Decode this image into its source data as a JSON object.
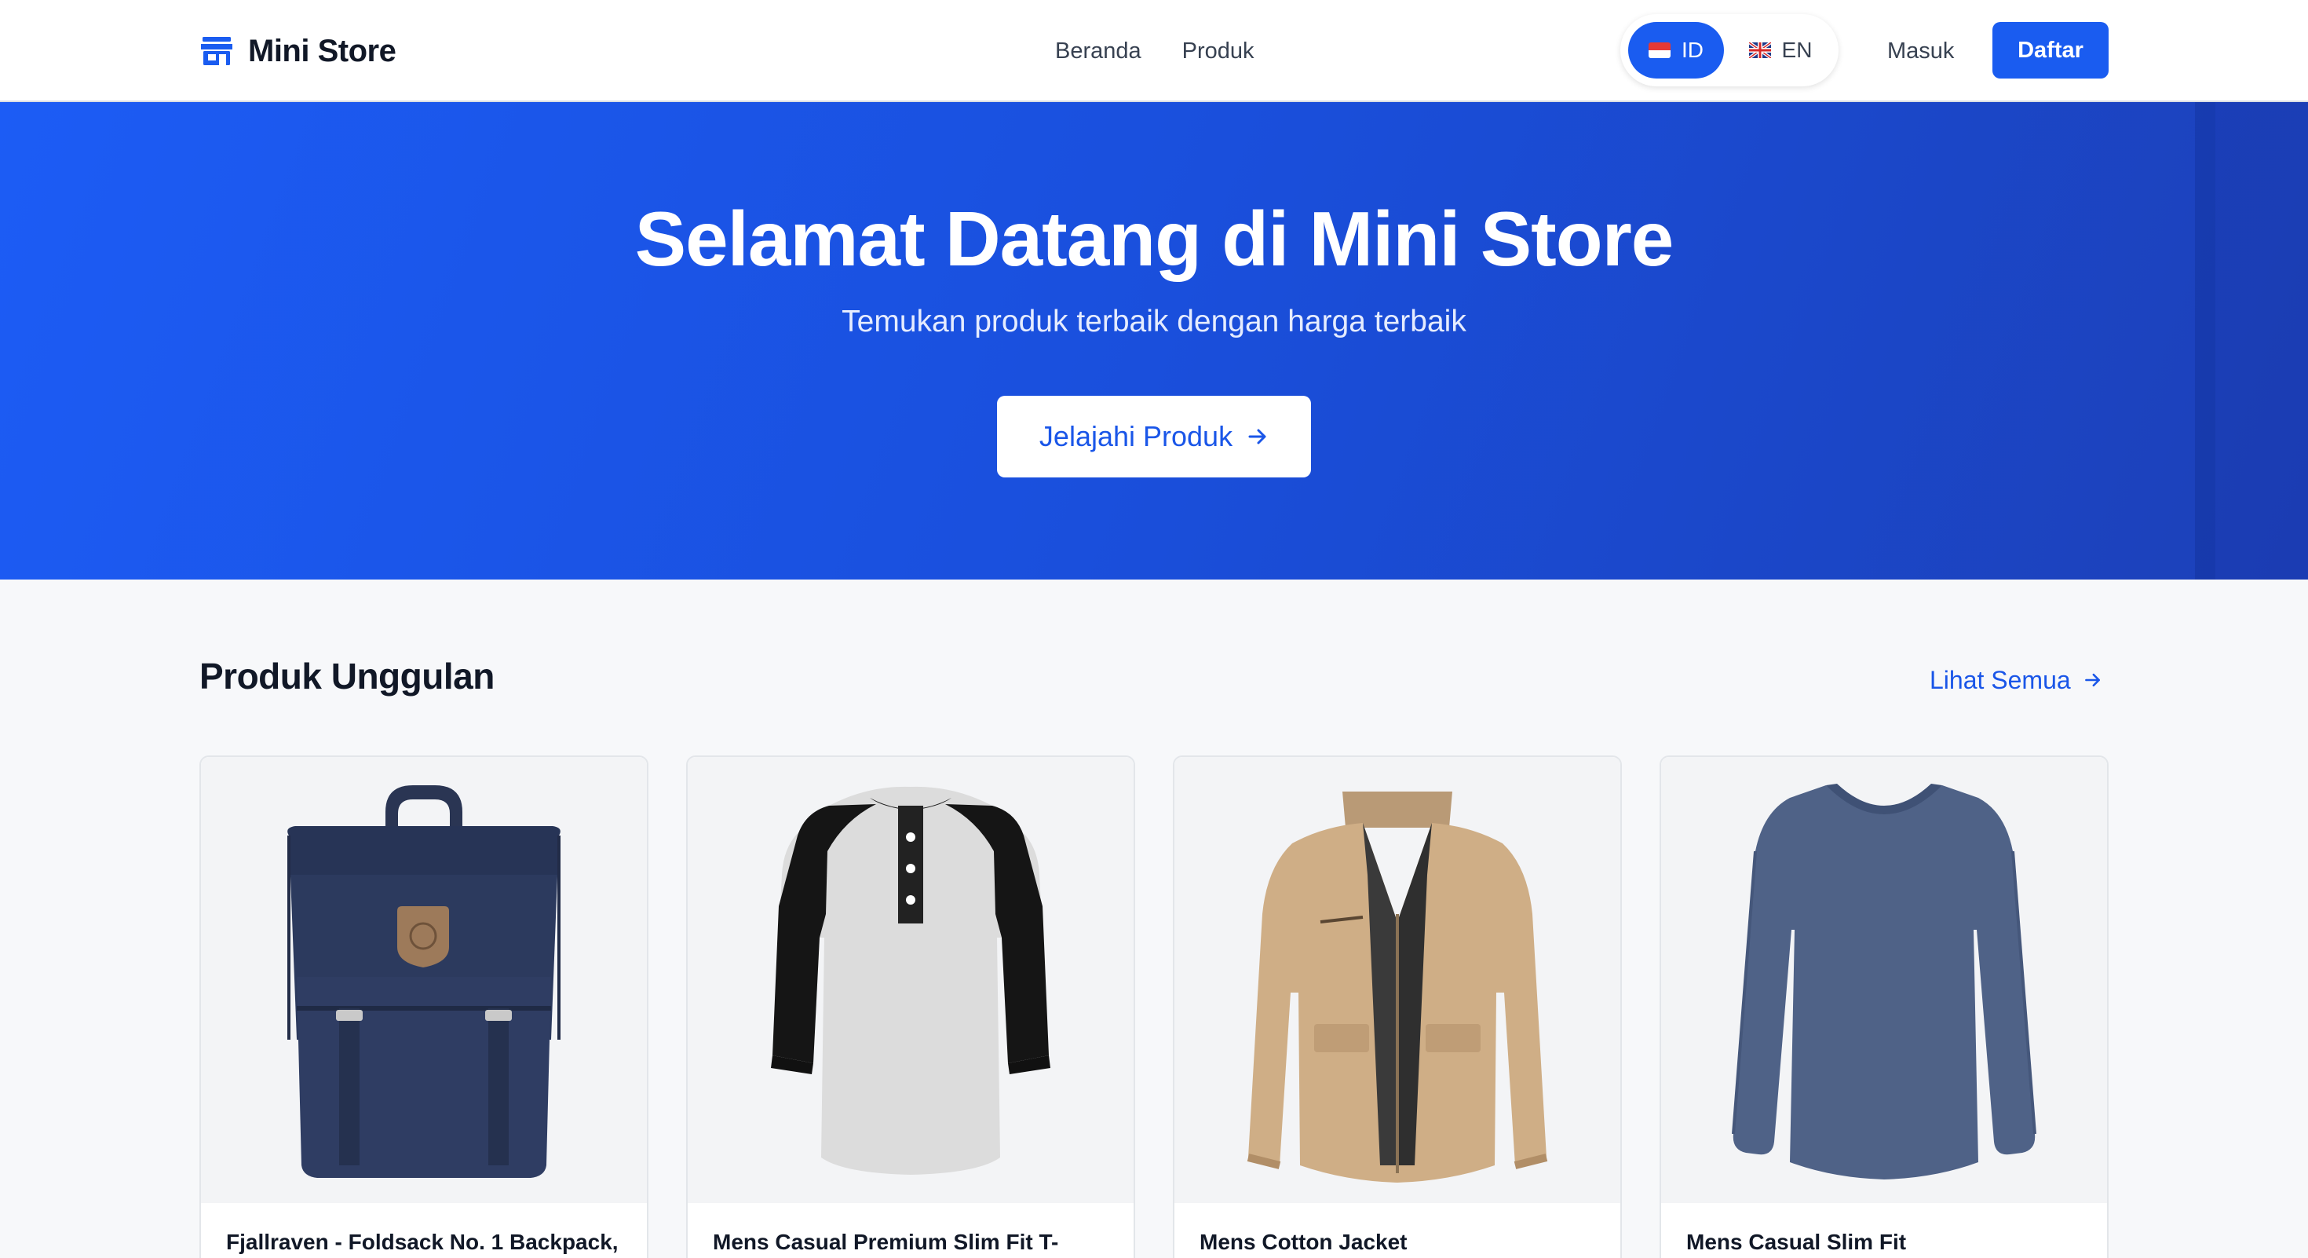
{
  "brand": {
    "name": "Mini Store",
    "icon": "store-icon"
  },
  "nav": {
    "links": [
      "Beranda",
      "Produk"
    ]
  },
  "language": {
    "options": [
      {
        "code": "ID",
        "flag": "indonesia-flag-icon",
        "active": true
      },
      {
        "code": "EN",
        "flag": "uk-flag-icon",
        "active": false
      }
    ]
  },
  "auth": {
    "login_label": "Masuk",
    "signup_label": "Daftar"
  },
  "hero": {
    "title": "Selamat Datang di Mini Store",
    "subtitle": "Temukan produk terbaik dengan harga terbaik",
    "cta_label": "Jelajahi Produk",
    "cta_icon": "arrow-right-icon"
  },
  "featured": {
    "title": "Produk Unggulan",
    "see_all_label": "Lihat Semua",
    "products": [
      {
        "title": "Fjallraven - Foldsack No. 1 Backpack,",
        "image": "backpack-image"
      },
      {
        "title": "Mens Casual Premium Slim Fit T-",
        "image": "raglan-tshirt-image"
      },
      {
        "title": "Mens Cotton Jacket",
        "image": "cotton-jacket-image"
      },
      {
        "title": "Mens Casual Slim Fit",
        "image": "long-sleeve-shirt-image"
      }
    ]
  },
  "colors": {
    "accent": "#1a5cf0",
    "hero_gradient_start": "#1c5cf5",
    "hero_gradient_end": "#1c40b8",
    "page_background": "#f7f8fa"
  }
}
